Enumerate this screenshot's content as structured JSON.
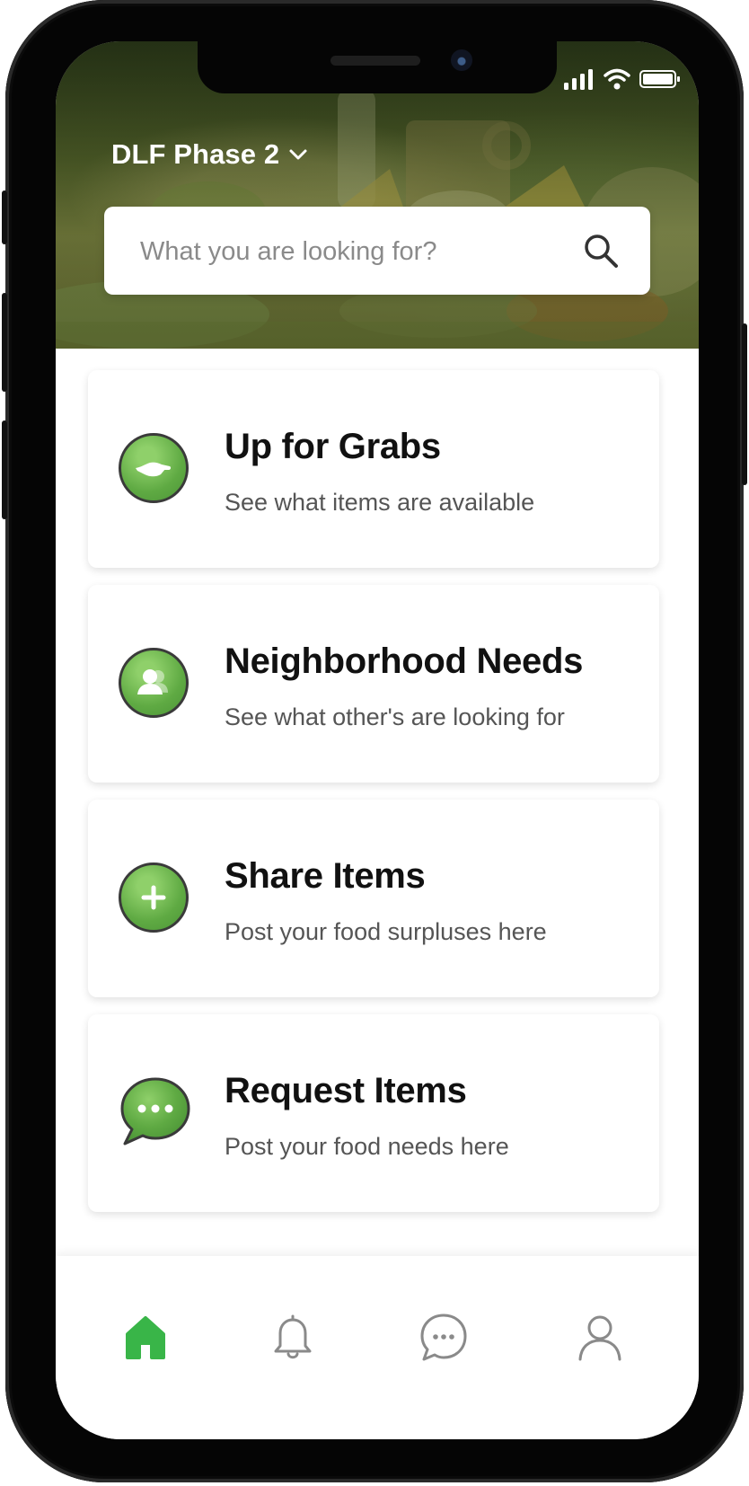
{
  "header": {
    "location": "DLF Phase 2",
    "search_placeholder": "What you are looking for?"
  },
  "cards": [
    {
      "title": "Up for Grabs",
      "subtitle": "See what items are available",
      "icon": "hand-icon"
    },
    {
      "title": "Neighborhood Needs",
      "subtitle": "See what other's are looking for",
      "icon": "people-icon"
    },
    {
      "title": "Share Items",
      "subtitle": "Post your food surpluses here",
      "icon": "plus-icon"
    },
    {
      "title": "Request Items",
      "subtitle": "Post your food needs here",
      "icon": "chat-bubble-icon"
    }
  ],
  "tabs": [
    {
      "icon": "home-icon",
      "active": true
    },
    {
      "icon": "bell-icon",
      "active": false
    },
    {
      "icon": "message-icon",
      "active": false
    },
    {
      "icon": "profile-icon",
      "active": false
    }
  ],
  "colors": {
    "accent": "#39b548",
    "icon_green": "#5faa43",
    "text_dark": "#111111",
    "text_muted": "#555555"
  }
}
